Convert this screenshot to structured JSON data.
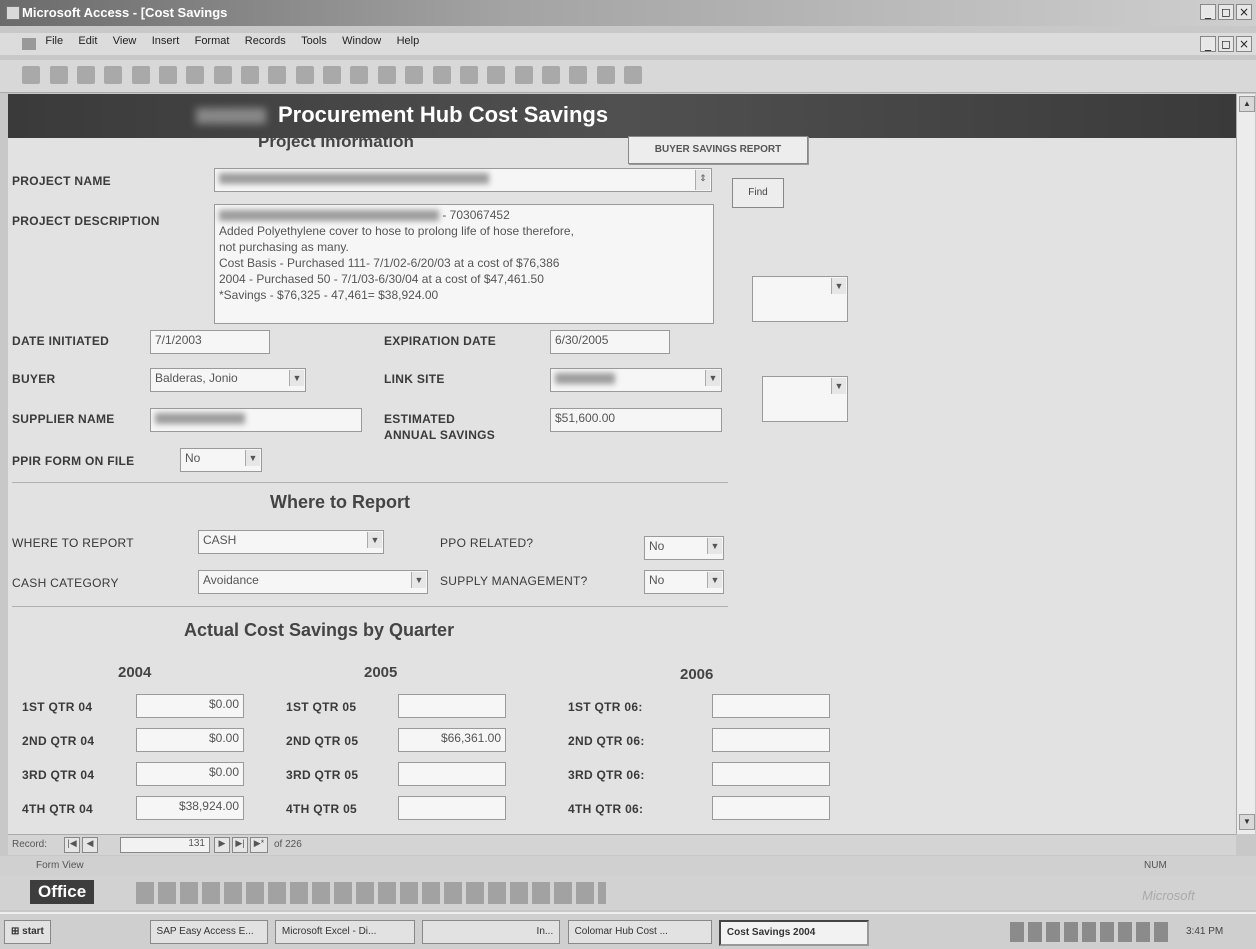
{
  "window": {
    "title": "Microsoft Access - [Cost Savings"
  },
  "menu": [
    "File",
    "Edit",
    "View",
    "Insert",
    "Format",
    "Records",
    "Tools",
    "Window",
    "Help"
  ],
  "form": {
    "header_title": "Procurement Hub Cost Savings",
    "project_info_heading": "Project Information",
    "buyer_savings_report_label": "BUYER SAVINGS REPORT",
    "find_label": "Find",
    "project_name_label": "PROJECT NAME",
    "project_description_label": "PROJECT DESCRIPTION",
    "description_lines": [
      "- 703067452",
      "Added Polyethylene cover to hose to prolong life of hose therefore,",
      "not purchasing as many.",
      "Cost Basis - Purchased 111- 7/1/02-6/20/03 at a cost of $76,386",
      "2004 - Purchased 50 - 7/1/03-6/30/04 at a cost of $47,461.50",
      "*Savings - $76,325 - 47,461= $38,924.00"
    ],
    "date_initiated_label": "DATE INITIATED",
    "date_initiated": "7/1/2003",
    "expiration_date_label": "EXPIRATION DATE",
    "expiration_date": "6/30/2005",
    "buyer_label": "BUYER",
    "buyer": "Balderas, Jonio",
    "link_site_label": "LINK SITE",
    "supplier_name_label": "SUPPLIER NAME",
    "estimated_label_1": "ESTIMATED",
    "estimated_label_2": "ANNUAL SAVINGS",
    "estimated_annual_savings": "$51,600.00",
    "ppir_label": "PPIR FORM ON FILE",
    "ppir": "No",
    "where_heading": "Where to Report",
    "where_to_report_label": "WHERE TO REPORT",
    "where_to_report": "CASH",
    "ppo_related_label": "PPO RELATED?",
    "ppo_related": "No",
    "cash_category_label": "CASH CATEGORY",
    "cash_category": "Avoidance",
    "supply_mgmt_label": "SUPPLY MANAGEMENT?",
    "supply_mgmt": "No",
    "quarter_heading": "Actual Cost Savings by Quarter",
    "years": [
      "2004",
      "2005",
      "2006"
    ],
    "quarters_2004": [
      {
        "label": "1ST QTR 04",
        "value": "$0.00"
      },
      {
        "label": "2ND QTR 04",
        "value": "$0.00"
      },
      {
        "label": "3RD QTR 04",
        "value": "$0.00"
      },
      {
        "label": "4TH QTR 04",
        "value": "$38,924.00"
      }
    ],
    "quarters_2005": [
      {
        "label": "1ST QTR 05",
        "value": ""
      },
      {
        "label": "2ND QTR 05",
        "value": "$66,361.00"
      },
      {
        "label": "3RD QTR 05",
        "value": ""
      },
      {
        "label": "4TH QTR 05",
        "value": ""
      }
    ],
    "quarters_2006": [
      {
        "label": "1ST QTR 06:",
        "value": ""
      },
      {
        "label": "2ND QTR 06:",
        "value": ""
      },
      {
        "label": "3RD QTR 06:",
        "value": ""
      },
      {
        "label": "4TH QTR 06:",
        "value": ""
      }
    ]
  },
  "record_nav": {
    "label": "Record:",
    "current": "131",
    "total": "of 226"
  },
  "status": {
    "left": "Form View",
    "num": "NUM",
    "brand": "Microsoft"
  },
  "officebar": {
    "label": "Office"
  },
  "taskbar": {
    "start": "start",
    "tasks": [
      "SAP Easy Access E...",
      "Microsoft Excel - Di...",
      "In...",
      "Colomar Hub Cost ...",
      "Cost Savings 2004"
    ],
    "clock": "3:41 PM"
  }
}
